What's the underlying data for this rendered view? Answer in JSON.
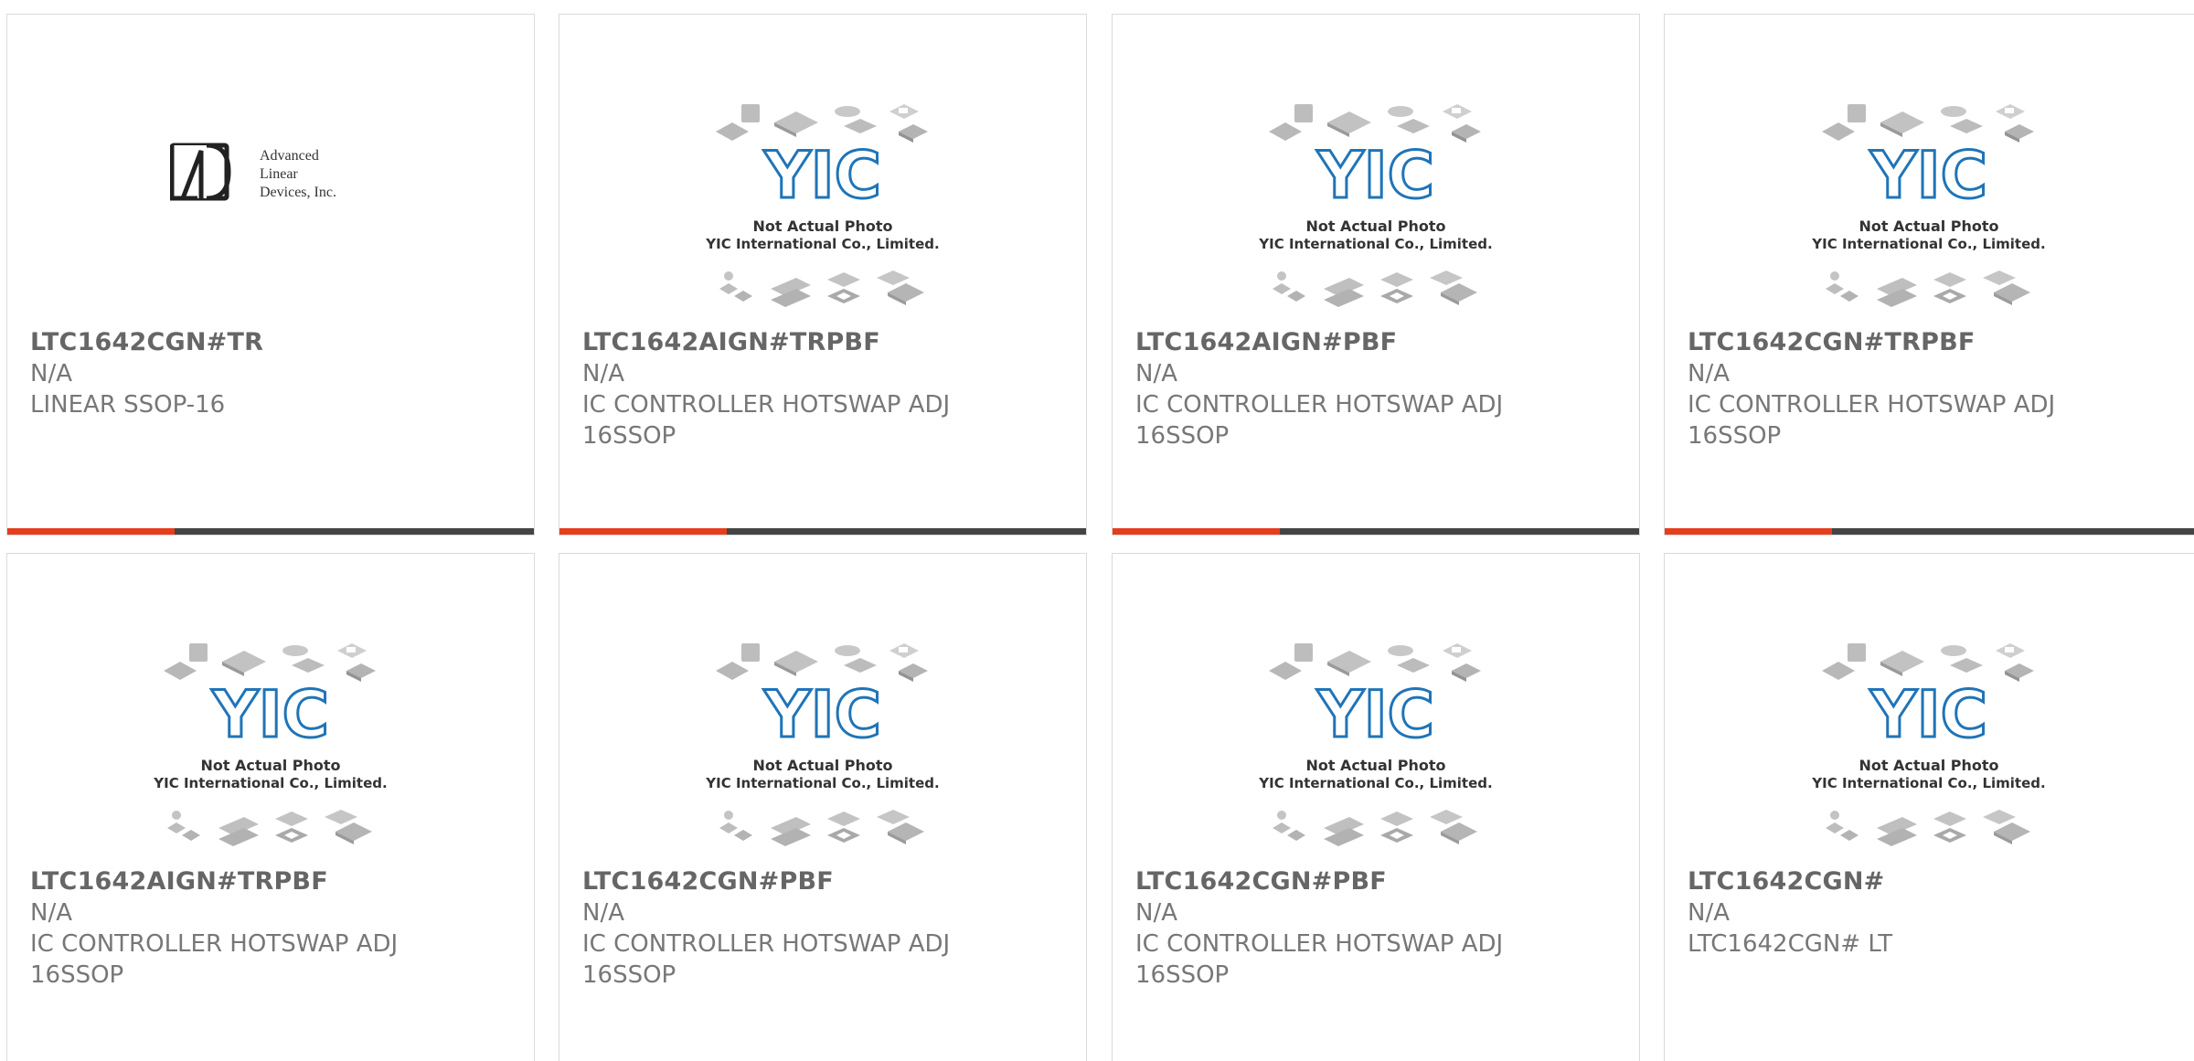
{
  "colors": {
    "accent": "#e63e1d",
    "bar_dark": "#444444",
    "yic_blue": "#1f74b8",
    "text_dark": "#666666",
    "text_light": "#777777"
  },
  "yic_placeholder": {
    "logo_text": "YIC",
    "caption1": "Not Actual Photo",
    "caption2": "YIC International Co., Limited."
  },
  "adi_logo": {
    "line1": "Advanced",
    "line2": "Linear",
    "line3": "Devices, Inc."
  },
  "products": [
    {
      "part": "LTC1642CGN#TR",
      "availability": "N/A",
      "desc1": "LINEAR SSOP-16",
      "desc2": "",
      "image": "adi-logo"
    },
    {
      "part": "LTC1642AIGN#TRPBF",
      "availability": "N/A",
      "desc1": "IC CONTROLLER HOTSWAP ADJ",
      "desc2": "16SSOP",
      "image": "yic-placeholder"
    },
    {
      "part": "LTC1642AIGN#PBF",
      "availability": "N/A",
      "desc1": "IC CONTROLLER HOTSWAP ADJ",
      "desc2": "16SSOP",
      "image": "yic-placeholder"
    },
    {
      "part": "LTC1642CGN#TRPBF",
      "availability": "N/A",
      "desc1": "IC CONTROLLER HOTSWAP ADJ",
      "desc2": "16SSOP",
      "image": "yic-placeholder"
    },
    {
      "part": "LTC1642AIGN#TRPBF",
      "availability": "N/A",
      "desc1": "IC CONTROLLER HOTSWAP ADJ",
      "desc2": "16SSOP",
      "image": "yic-placeholder"
    },
    {
      "part": "LTC1642CGN#PBF",
      "availability": "N/A",
      "desc1": "IC CONTROLLER HOTSWAP ADJ",
      "desc2": "16SSOP",
      "image": "yic-placeholder"
    },
    {
      "part": "LTC1642CGN#PBF",
      "availability": "N/A",
      "desc1": "IC CONTROLLER HOTSWAP ADJ",
      "desc2": "16SSOP",
      "image": "yic-placeholder"
    },
    {
      "part": "LTC1642CGN#",
      "availability": "N/A",
      "desc1": "LTC1642CGN# LT",
      "desc2": "",
      "image": "yic-placeholder"
    }
  ]
}
